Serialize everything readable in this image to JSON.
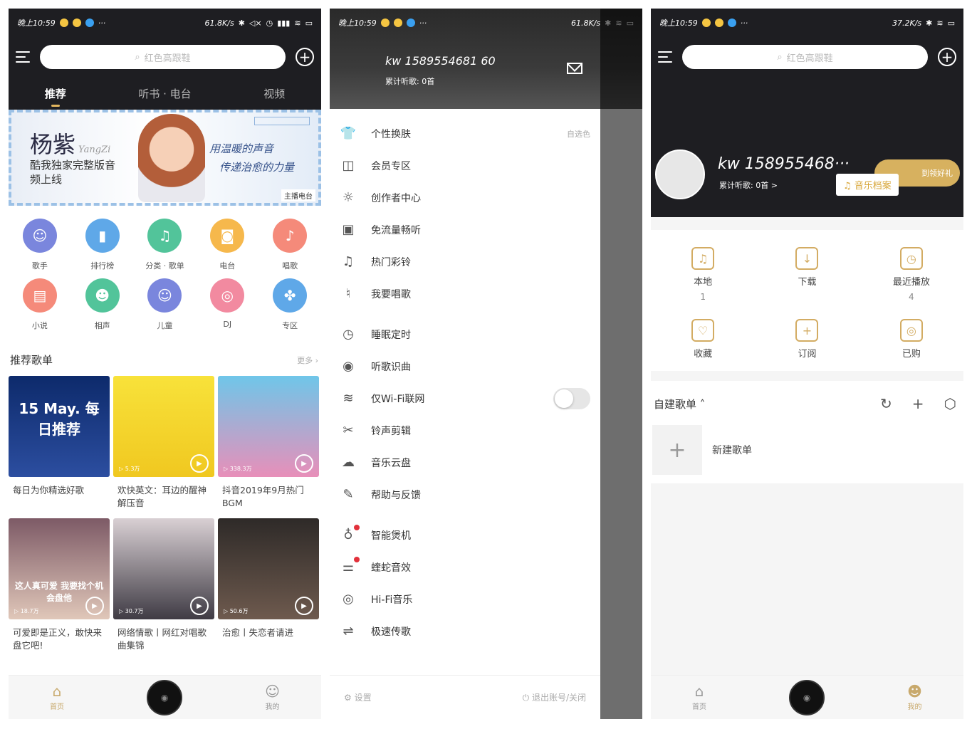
{
  "status": {
    "time": "晚上10:59",
    "speed_p1": "61.8K/s",
    "speed_p2": "61.8K/s",
    "speed_p3": "37.2K/s",
    "more": "···"
  },
  "home": {
    "search_placeholder": "红色高跟鞋",
    "tabs": [
      "推荐",
      "听书 · 电台",
      "视频"
    ],
    "banner": {
      "name": "杨紫",
      "name_en": "YangZi",
      "sub": "酷我独家完整版音频上线",
      "quote1": "用温暖的声音",
      "quote2": "传递治愈的力量",
      "tag": "主播电台"
    },
    "icons": [
      {
        "label": "歌手",
        "color": "#7a86dd",
        "glyph": "☺"
      },
      {
        "label": "排行榜",
        "color": "#5fa8e8",
        "glyph": "▮"
      },
      {
        "label": "分类 · 歌单",
        "color": "#52c49a",
        "glyph": "♫"
      },
      {
        "label": "电台",
        "color": "#f6b84c",
        "glyph": "◙"
      },
      {
        "label": "唱歌",
        "color": "#f58a7a",
        "glyph": "♪"
      },
      {
        "label": "小说",
        "color": "#f58a7a",
        "glyph": "▤"
      },
      {
        "label": "相声",
        "color": "#52c49a",
        "glyph": "☻"
      },
      {
        "label": "儿童",
        "color": "#7a86dd",
        "glyph": "☺"
      },
      {
        "label": "DJ",
        "color": "#f28aa0",
        "glyph": "◎"
      },
      {
        "label": "专区",
        "color": "#5fa8e8",
        "glyph": "✤"
      }
    ],
    "section_title": "推荐歌单",
    "section_more": "更多",
    "cards": [
      {
        "title": "每日为你精选好歌",
        "plays": "",
        "cover": "linear-gradient(180deg,#0d2a6b,#2c4ea0)",
        "overlay": "15 May. 每日推荐"
      },
      {
        "title": "欢快英文：耳边的醒神解压音",
        "plays": "5.3万",
        "cover": "linear-gradient(180deg,#f8e23a,#f0c820)",
        "overlay": ""
      },
      {
        "title": "抖音2019年9月热门BGM",
        "plays": "338.3万",
        "cover": "linear-gradient(180deg,#6fc6e9,#e88fb9)",
        "overlay": ""
      },
      {
        "title": "可爱即是正义，敢快来盘它吧!",
        "plays": "18.7万",
        "cover": "linear-gradient(180deg,#7d5a66,#e0c7b9)",
        "overlay": "这人真可爱 我要找个机会盘他"
      },
      {
        "title": "网络情歌丨网红对唱歌曲集锦",
        "plays": "30.7万",
        "cover": "linear-gradient(180deg,#d9d0d4,#3f3b44)",
        "overlay": ""
      },
      {
        "title": "治愈丨失恋者请进",
        "plays": "50.6万",
        "cover": "linear-gradient(180deg,#2e2a28,#6e5a4e)",
        "overlay": ""
      }
    ],
    "nav": [
      "首页",
      "我的"
    ]
  },
  "drawer": {
    "user": "kw 1589554681 60",
    "listened": "累计听歌: 0首",
    "groups": [
      [
        {
          "icon": "shirt-icon",
          "glyph": "👕",
          "label": "个性换肤",
          "extra": "自选色"
        },
        {
          "icon": "vip-icon",
          "glyph": "◫",
          "label": "会员专区",
          "extra": ""
        },
        {
          "icon": "bulb-icon",
          "glyph": "☼",
          "label": "创作者中心",
          "extra": ""
        },
        {
          "icon": "sim-icon",
          "glyph": "▣",
          "label": "免流量畅听",
          "extra": ""
        },
        {
          "icon": "bell-icon",
          "glyph": "♫",
          "label": "热门彩铃",
          "extra": ""
        },
        {
          "icon": "mic-icon",
          "glyph": "♮",
          "label": "我要唱歌",
          "extra": ""
        }
      ],
      [
        {
          "icon": "timer-icon",
          "glyph": "◷",
          "label": "睡眠定时",
          "extra": ""
        },
        {
          "icon": "recognize-icon",
          "glyph": "◉",
          "label": "听歌识曲",
          "extra": ""
        },
        {
          "icon": "wifi-icon",
          "glyph": "≋",
          "label": "仅Wi-Fi联网",
          "extra": "toggle"
        },
        {
          "icon": "ringtone-icon",
          "glyph": "✂",
          "label": "铃声剪辑",
          "extra": ""
        },
        {
          "icon": "cloud-icon",
          "glyph": "☁",
          "label": "音乐云盘",
          "extra": ""
        },
        {
          "icon": "feedback-icon",
          "glyph": "✎",
          "label": "帮助与反馈",
          "extra": ""
        }
      ],
      [
        {
          "icon": "headphone-icon",
          "glyph": "♁",
          "label": "智能煲机",
          "extra": "dot"
        },
        {
          "icon": "equalizer-icon",
          "glyph": "⚌",
          "label": "蝰蛇音效",
          "extra": "dot"
        },
        {
          "icon": "hifi-icon",
          "glyph": "◎",
          "label": "Hi-Fi音乐",
          "extra": ""
        },
        {
          "icon": "transfer-icon",
          "glyph": "⇌",
          "label": "极速传歌",
          "extra": ""
        }
      ]
    ],
    "settings": "设置",
    "logout": "退出账号/关闭"
  },
  "mine": {
    "search_placeholder": "红色高跟鞋",
    "user": "kw 158955468···",
    "listened": "累计听歌: 0首 >",
    "signin": "到领好礼",
    "archive": "音乐档案",
    "quick": [
      {
        "label": "本地",
        "num": "1",
        "glyph": "♫"
      },
      {
        "label": "下载",
        "num": "",
        "glyph": "↓"
      },
      {
        "label": "最近播放",
        "num": "4",
        "glyph": "◷"
      },
      {
        "label": "收藏",
        "num": "",
        "glyph": "♡"
      },
      {
        "label": "订阅",
        "num": "",
        "glyph": "+"
      },
      {
        "label": "已购",
        "num": "",
        "glyph": "◎"
      }
    ],
    "playlist_title": "自建歌单",
    "new_playlist": "新建歌单",
    "nav": [
      "首页",
      "我的"
    ]
  }
}
